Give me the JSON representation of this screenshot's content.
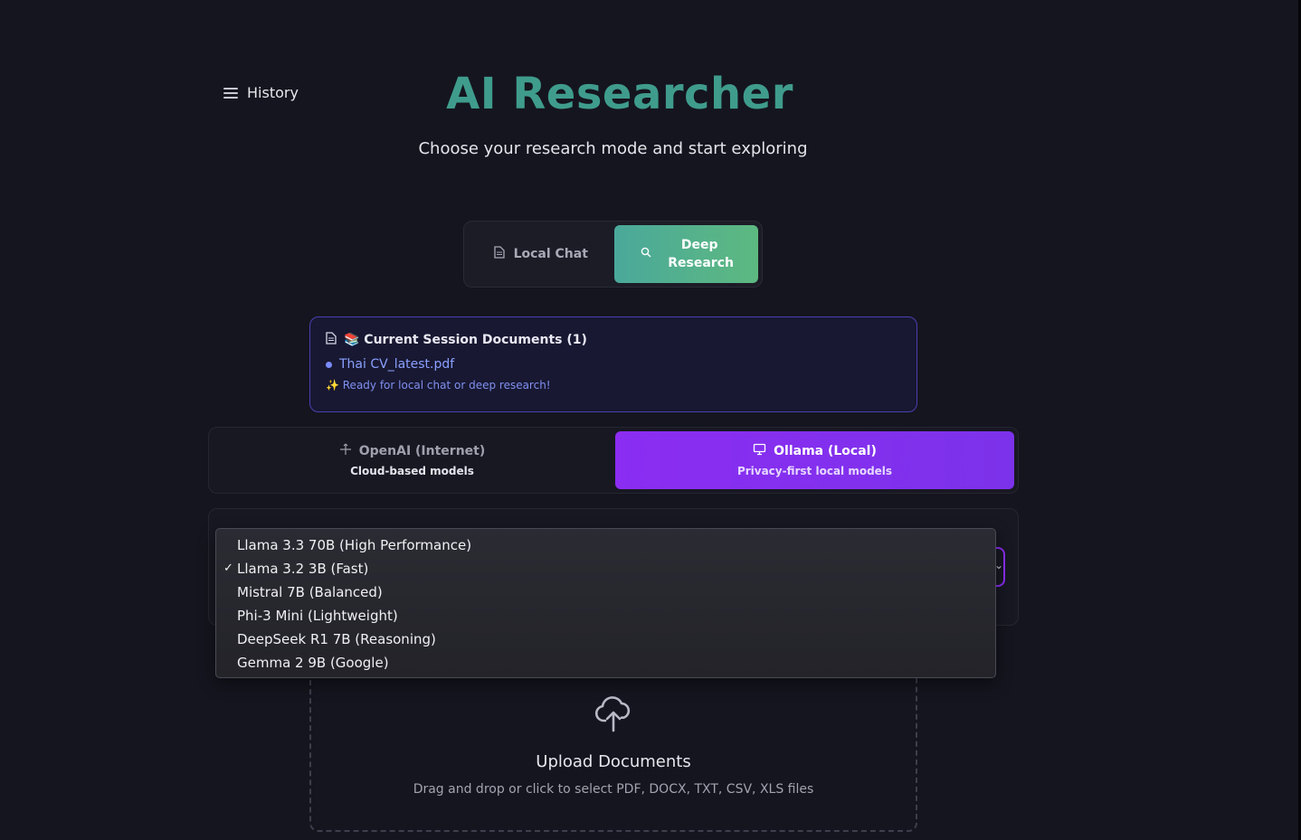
{
  "history": {
    "label": "History"
  },
  "header": {
    "title": "AI Researcher",
    "subtitle": "Choose your research mode and start exploring"
  },
  "modes": {
    "local_chat": "Local Chat",
    "deep_research": "Deep Research",
    "active": "deep_research"
  },
  "session": {
    "heading": "📚 Current Session Documents (1)",
    "files": [
      "Thai CV_latest.pdf"
    ],
    "note": "✨ Ready for local chat or deep research!"
  },
  "providers": {
    "openai": {
      "title": "OpenAI (Internet)",
      "subtitle": "Cloud-based models"
    },
    "ollama": {
      "title": "Ollama (Local)",
      "subtitle": "Privacy-first local models"
    },
    "active": "ollama"
  },
  "model_select": {
    "selected": "Llama 3.2 3B (Fast)",
    "options": [
      "Llama 3.3 70B (High Performance)",
      "Llama 3.2 3B (Fast)",
      "Mistral 7B (Balanced)",
      "Phi-3 Mini (Lightweight)",
      "DeepSeek R1 7B (Reasoning)",
      "Gemma 2 9B (Google)"
    ]
  },
  "upload": {
    "title": "Upload Documents",
    "subtitle": "Drag and drop or click to select PDF, DOCX, TXT, CSV, XLS files"
  },
  "colors": {
    "background": "#15151f",
    "accent_green": "#4aa89a",
    "accent_purple": "#8b2df2",
    "session_border": "#4a3fb0"
  }
}
